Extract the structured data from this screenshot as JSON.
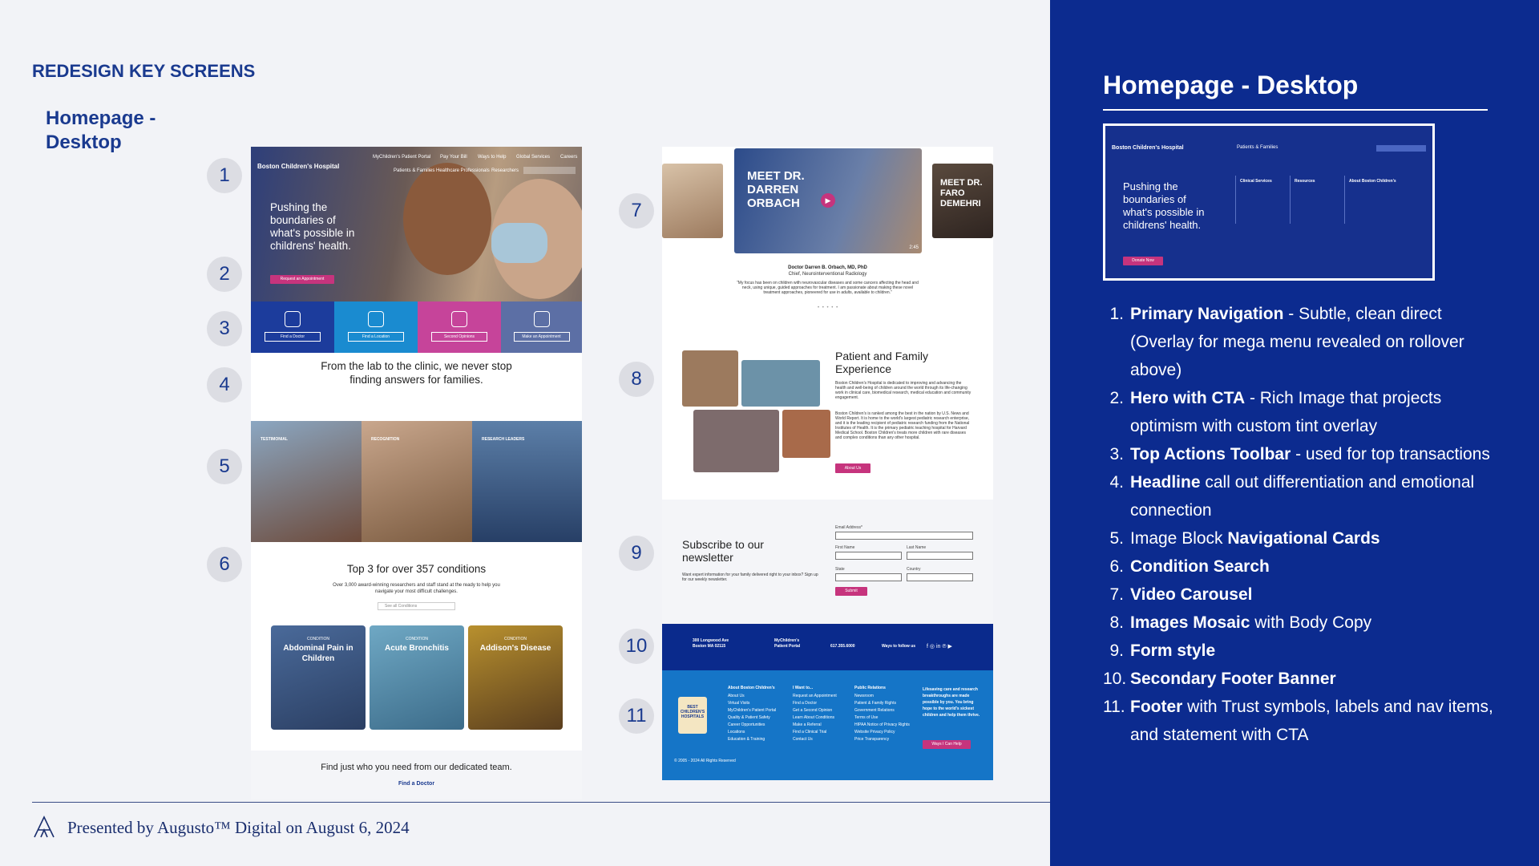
{
  "slide": {
    "kicker": "REDESIGN KEY SCREENS",
    "subtitle": "Homepage - Desktop",
    "presented_by": "Presented by Augusto™ Digital on August 6, 2024"
  },
  "markers": [
    "1",
    "2",
    "3",
    "4",
    "5",
    "6",
    "7",
    "8",
    "9",
    "10",
    "11"
  ],
  "screen1": {
    "nav": {
      "logo": "Boston Children's Hospital",
      "top_links": [
        "MyChildren's Patient Portal",
        "Pay Your Bill",
        "Ways to Help",
        "Global Services",
        "Careers"
      ],
      "main_links": [
        "Patients & Families",
        "Healthcare Professionals",
        "Researchers"
      ]
    },
    "hero_text": "Pushing the boundaries of what's possible in childrens' health.",
    "hero_cta": "Request an Appointment",
    "toolbar": [
      "Find a Doctor",
      "Find a Location",
      "Second Opinions",
      "Make an Appointment"
    ],
    "headline": "From the lab to the clinic, we never stop finding answers for families.",
    "cards": [
      "TESTIMONIAL",
      "RECOGNITION",
      "RESEARCH LEADERS"
    ],
    "conditions": {
      "title": "Top 3 for over 357 conditions",
      "subtitle": "Over 3,000 award-winning researchers and staff stand at the ready to help you navigate your most difficult challenges.",
      "search": "See all Conditions",
      "kicker": "CONDITION",
      "items": [
        "Abdominal Pain in Children",
        "Acute Bronchitis",
        "Addison's Disease"
      ]
    },
    "team": {
      "text": "Find just who you need from our dedicated team.",
      "link": "Find a Doctor"
    }
  },
  "screen2": {
    "video_title": "MEET DR. DARREN ORBACH",
    "video_side": "MEET DR. FARO DEMEHRI",
    "duration": "2:45",
    "doctor_name": "Doctor Darren B. Orbach, MD, PhD",
    "doctor_role": "Chief, Neurointerventional Radiology",
    "doctor_quote": "“My focus has been on children with neurovascular diseases and some cancers affecting the head and neck, using unique, guided approaches for treatment. I am passionate about making these novel treatment approaches, pioneered for use in adults, available to children.”",
    "patient_title": "Patient and Family Experience",
    "patient_p1": "Boston Children's Hospital is dedicated to improving and advancing the health and well-being of children around the world through its life-changing work in clinical care, biomedical research, medical education and community engagement.",
    "patient_p2": "Boston Children's is ranked among the best in the nation by U.S. News and World Report. It is home to the world's largest pediatric research enterprise, and it is the leading recipient of pediatric research funding from the National Institutes of Health. It is the primary pediatric teaching hospital for Harvard Medical School. Boston Children's treats more children with rare diseases and complex conditions than any other hospital.",
    "about_btn": "About Us",
    "newsletter": {
      "title": "Subscribe to our newsletter",
      "desc": "Want expert information for your family delivered right to your inbox? Sign up for our weekly newsletter.",
      "email": "Email Address*",
      "first": "First Name",
      "last": "Last Name",
      "state": "State",
      "country": "Country",
      "submit": "Submit"
    },
    "banner": {
      "address": "300 Longwood Ave Boston MA 02115",
      "portal": "MyChildren's Patient Portal",
      "phone": "617.355.6000",
      "follow": "Ways to follow us"
    },
    "footer": {
      "badge": "BEST CHILDREN'S HOSPITALS",
      "cols": [
        {
          "h": "About Boston Children's",
          "items": [
            "About Us",
            "Virtual Visits",
            "MyChildren's Patient Portal",
            "Quality & Patient Safety",
            "Career Opportunities",
            "Locations",
            "Education & Training"
          ]
        },
        {
          "h": "I Want to...",
          "items": [
            "Request an Appointment",
            "Find a Doctor",
            "Get a Second Opinion",
            "Learn About Conditions",
            "Make a Referral",
            "Find a Clinical Trial",
            "Contact Us"
          ]
        },
        {
          "h": "Public Relations",
          "items": [
            "Newsroom",
            "Patient & Family Rights",
            "Government Relations",
            "Terms of Use",
            "HIPAA Notice of Privacy Rights",
            "Website Privacy Policy",
            "Price Transparency"
          ]
        }
      ],
      "statement": "Lifesaving care and research breakthroughs are made possible by you. You bring hope to the world's sickest children and help them thrive.",
      "cta": "Ways I Can Help",
      "copyright": "© 2005 - 2024 All Rights Reserved"
    }
  },
  "panel": {
    "title": "Homepage - Desktop",
    "thumb": {
      "logo": "Boston Children's Hospital",
      "hero": "Pushing the boundaries of what's possible in childrens' health.",
      "donate": "Donate Now",
      "menu": "Patients & Families",
      "col1": "Clinical Services",
      "col2": "Resources",
      "col3": "About Boston Children's"
    },
    "items": [
      {
        "n": "1.",
        "bold": "Primary Navigation",
        "rest": " - Subtle, clean direct (Overlay for mega menu revealed on rollover above)",
        "pre": ""
      },
      {
        "n": "2.",
        "bold": "Hero with CTA",
        "rest": " - Rich Image that projects optimism with custom tint overlay",
        "pre": ""
      },
      {
        "n": "3.",
        "bold": "Top Actions Toolbar",
        "rest": " - used for top transactions",
        "pre": ""
      },
      {
        "n": "4.",
        "bold": "Headline",
        "rest": " call out differentiation and emotional connection",
        "pre": ""
      },
      {
        "n": "5.",
        "bold": "Navigational Cards",
        "rest": "",
        "pre": "Image Block "
      },
      {
        "n": "6.",
        "bold": "Condition Search",
        "rest": "",
        "pre": ""
      },
      {
        "n": "7.",
        "bold": "Video Carousel",
        "rest": "",
        "pre": ""
      },
      {
        "n": "8.",
        "bold": "Images Mosaic",
        "rest": " with Body Copy",
        "pre": ""
      },
      {
        "n": "9.",
        "bold": "Form style",
        "rest": "",
        "pre": ""
      },
      {
        "n": "10.",
        "bold": "Secondary Footer Banner",
        "rest": "",
        "pre": ""
      },
      {
        "n": "11.",
        "bold": "Footer",
        "rest": " with Trust symbols, labels and nav items, and statement with CTA",
        "pre": ""
      }
    ]
  },
  "colors": {
    "brand_blue": "#0c2b8f",
    "accent_pink": "#c6347d",
    "toolbar_blue": "#1a8bd0"
  }
}
